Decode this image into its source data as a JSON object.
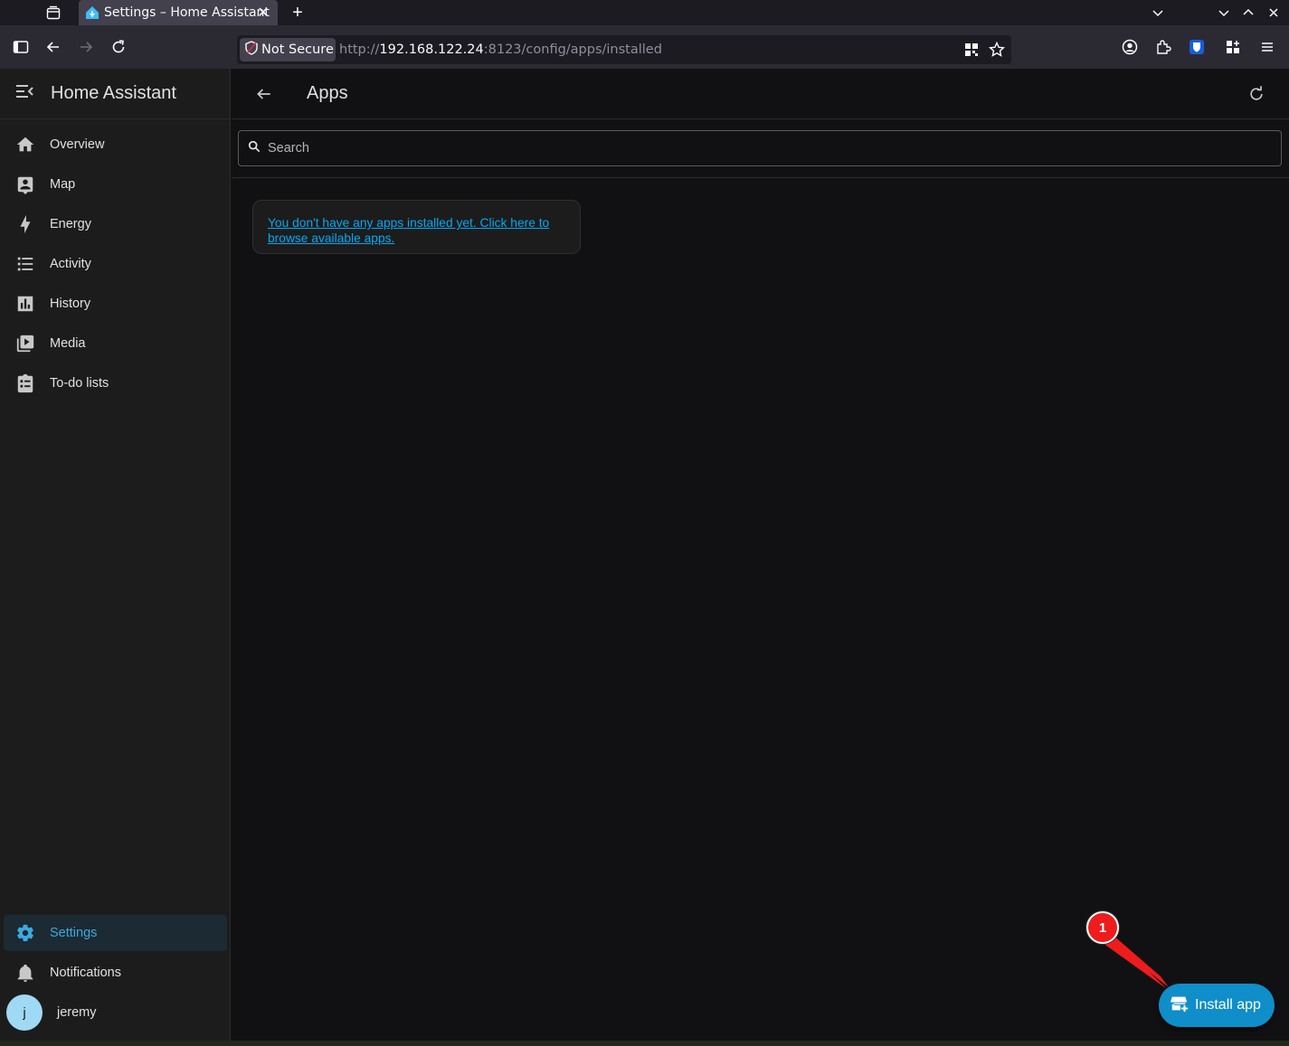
{
  "browser": {
    "tab_title": "Settings – Home Assistant",
    "security_label": "Not Secure",
    "url_prefix": "http://",
    "url_host": "192.168.122.24",
    "url_rest": ":8123/config/apps/installed"
  },
  "sidebar": {
    "title": "Home Assistant",
    "items": [
      {
        "label": "Overview",
        "icon": "home-icon"
      },
      {
        "label": "Map",
        "icon": "map-icon"
      },
      {
        "label": "Energy",
        "icon": "lightning-icon"
      },
      {
        "label": "Activity",
        "icon": "list-icon"
      },
      {
        "label": "History",
        "icon": "chart-icon"
      },
      {
        "label": "Media",
        "icon": "play-box-icon"
      },
      {
        "label": "To-do lists",
        "icon": "clipboard-list-icon"
      }
    ],
    "bottom": {
      "settings": "Settings",
      "notifications": "Notifications",
      "user_name": "jeremy",
      "user_initial": "j"
    }
  },
  "header": {
    "title": "Apps"
  },
  "search": {
    "placeholder": "Search"
  },
  "empty_state": {
    "line1": "You don't have any apps installed yet. Click here to",
    "line2": "browse available apps."
  },
  "fab": {
    "label": "Install app"
  },
  "annotation": {
    "number": "1"
  },
  "colors": {
    "accent": "#03a9f4",
    "fab": "#0f8ec9",
    "annotation": "#ee1c1c"
  }
}
